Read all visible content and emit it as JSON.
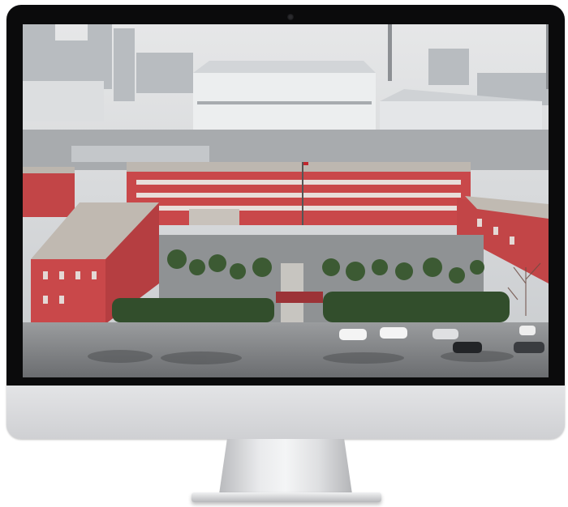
{
  "scene": {
    "subject": "monitor",
    "screen_content": "aerial-photo",
    "colors": {
      "bezel": "#0b0b0c",
      "stand": "#d9dadc",
      "sky": "#d8dadc",
      "brick": "#c9484a",
      "roof": "#b9b4ae",
      "pavement": "#8a8c8e",
      "trees": "#3c5a33"
    }
  }
}
